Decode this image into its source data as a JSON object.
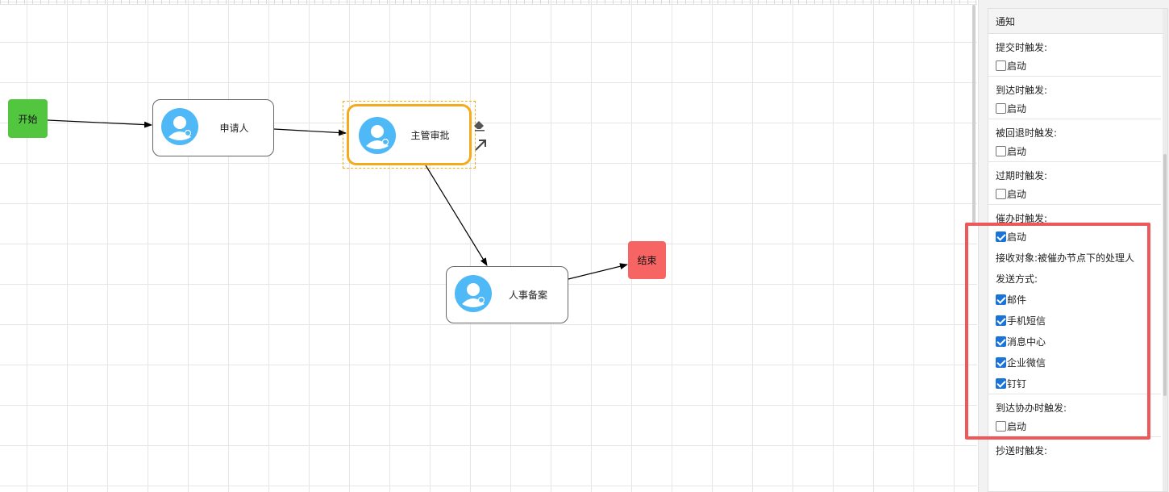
{
  "canvas": {
    "nodes": {
      "start": "开始",
      "applicant": "申请人",
      "supervisor": "主管审批",
      "hr": "人事备案",
      "end": "结束"
    },
    "colors": {
      "start": "#52c63e",
      "end": "#f76464",
      "selected_border": "#f5a91c",
      "avatar": "#4fb8f6"
    },
    "tools": [
      "eraser-icon",
      "connect-arrow-icon"
    ]
  },
  "panel": {
    "title": "通知",
    "sections": [
      {
        "title": "提交时触发:",
        "enable_label": "启动",
        "enabled": false
      },
      {
        "title": "到达时触发:",
        "enable_label": "启动",
        "enabled": false
      },
      {
        "title": "被回退时触发:",
        "enable_label": "启动",
        "enabled": false
      },
      {
        "title": "过期时触发:",
        "enable_label": "启动",
        "enabled": false
      },
      {
        "title": "催办时触发:",
        "enable_label": "启动",
        "enabled": true,
        "receiver": "接收对象:被催办节点下的处理人",
        "method_label": "发送方式:",
        "methods": [
          {
            "label": "邮件",
            "checked": true
          },
          {
            "label": "手机短信",
            "checked": true
          },
          {
            "label": "消息中心",
            "checked": true
          },
          {
            "label": "企业微信",
            "checked": true
          },
          {
            "label": "钉钉",
            "checked": true
          }
        ]
      },
      {
        "title": "到达协办时触发:",
        "enable_label": "启动",
        "enabled": false
      },
      {
        "title": "抄送时触发:"
      }
    ]
  },
  "highlight_color": "#ef5858"
}
